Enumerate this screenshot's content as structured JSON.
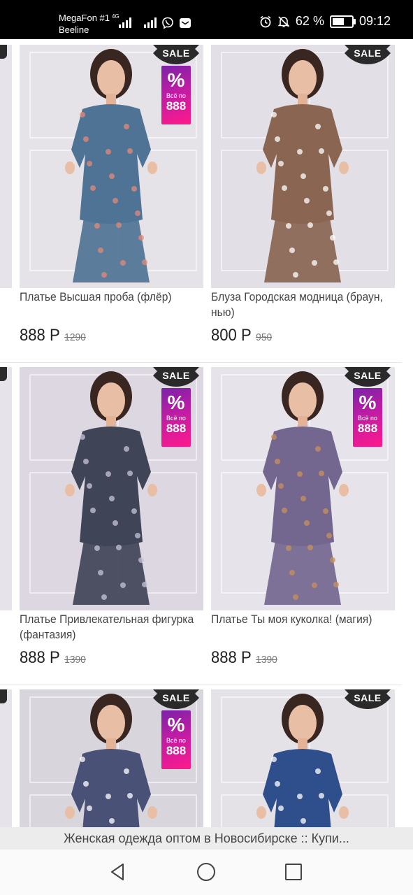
{
  "status_bar": {
    "carrier1": "MegaFon #1",
    "carrier2": "Beeline",
    "network": "4G",
    "battery_percent": "62 %",
    "battery_level": 0.62,
    "time": "09:12",
    "icons": [
      "signal-icon",
      "signal-icon",
      "viber-icon",
      "huawei-mail-icon",
      "alarm-icon",
      "mute-notification-icon",
      "battery-icon"
    ]
  },
  "products": [
    {
      "title_line1": "Платье Высшая проба (флёр)",
      "title_line2": "",
      "price": "888 Р",
      "old_price": "1290",
      "sale": "SALE",
      "promo": true,
      "colors": {
        "bg": "#e5e2e8",
        "outfit": "#4f7394",
        "accent": "#e48a78"
      }
    },
    {
      "title_line1": "Блуза Городская модница (браун,",
      "title_line2": "нью)",
      "price": "800 Р",
      "old_price": "950",
      "sale": "SALE",
      "promo": false,
      "colors": {
        "bg": "#e2dfe6",
        "outfit": "#8a6552",
        "accent": "#ffffff"
      }
    },
    {
      "title_line1": "Платье Привлекательная фигурка",
      "title_line2": "(фантазия)",
      "price": "888 Р",
      "old_price": "1390",
      "sale": "SALE",
      "promo": true,
      "colors": {
        "bg": "#dcd7e1",
        "outfit": "#3f4457",
        "accent": "#c9c3d8"
      }
    },
    {
      "title_line1": "Платье Ты моя куколка! (магия)",
      "title_line2": "",
      "price": "888 Р",
      "old_price": "1390",
      "sale": "SALE",
      "promo": true,
      "colors": {
        "bg": "#e6e4ea",
        "outfit": "#74678f",
        "accent": "#c8905a"
      }
    },
    {
      "title_line1": "",
      "title_line2": "",
      "price": "",
      "old_price": "",
      "sale": "SALE",
      "promo": true,
      "colors": {
        "bg": "#d8d6dc",
        "outfit": "#4a5177",
        "accent": "#ffffff"
      }
    },
    {
      "title_line1": "",
      "title_line2": "",
      "price": "",
      "old_price": "",
      "sale": "SALE",
      "promo": false,
      "colors": {
        "bg": "#e4e1e7",
        "outfit": "#2e4f8c",
        "accent": "#ffffff"
      }
    }
  ],
  "promo_badge": {
    "percent": "%",
    "text": "Всё по",
    "value": "888"
  },
  "page_title": "Женская одежда оптом в Новосибирске :: Купи...",
  "nav": {
    "back": "back-icon",
    "home": "home-icon",
    "recents": "recents-icon"
  }
}
